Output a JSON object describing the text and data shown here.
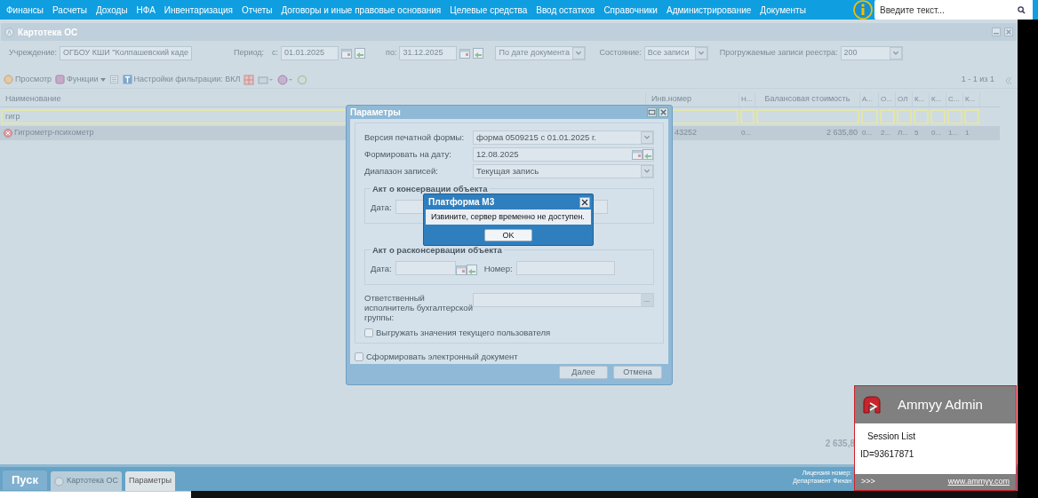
{
  "menu": [
    "Финансы",
    "Расчеты",
    "Доходы",
    "НФА",
    "Инвентаризация",
    "Отчеты",
    "Договоры и иные правовые основания",
    "Целевые средства",
    "Ввод остатков",
    "Справочники",
    "Администрирование",
    "Документы"
  ],
  "search": {
    "placeholder": "Введите текст..."
  },
  "window": {
    "title": "Картотека ОС"
  },
  "filters": {
    "institution_label": "Учреждение:",
    "institution_value": "ОГБОУ КШИ \"Колпашевский каде",
    "period_label": "Период:",
    "from_label": "с:",
    "from_value": "01.01.2025",
    "to_label": "по:",
    "to_value": "31.12.2025",
    "date_mode": "По дате документа",
    "state_label": "Состояние:",
    "state_value": "Все записи",
    "records_label": "Прогружаемые записи реестра:",
    "records_value": "200"
  },
  "toolbar": {
    "items": [
      {
        "label": "Просмотр",
        "kind": "view"
      },
      {
        "label": "Функции",
        "kind": "menu"
      },
      {
        "label": "Настройки фильтрации: ВКЛ",
        "kind": "filter"
      }
    ],
    "pager": "1 - 1 из 1"
  },
  "table": {
    "columns": [
      "Наименование",
      "Инв.номер",
      "Н...",
      "Балансовая стоимость",
      "А...",
      "О...",
      "ОЛ",
      "К...",
      "К...",
      "С...",
      "К..."
    ],
    "filter_value": "гигр",
    "rows": [
      {
        "selected": true,
        "cells": [
          "Гигрометр-психометр",
          "43252",
          "0...",
          "2 635,80",
          "0...",
          "2...",
          "Л...",
          "5",
          "0...",
          "1...",
          "1"
        ]
      }
    ],
    "total": "2 635,8"
  },
  "dialog": {
    "title": "Параметры",
    "fields": [
      {
        "kind": "select",
        "label": "Версия печатной формы:",
        "value": "форма 0509215 с 01.01.2025 г."
      },
      {
        "kind": "date",
        "label": "Формировать на дату:",
        "value": "12.08.2025"
      },
      {
        "kind": "select",
        "label": "Диапазон записей:",
        "value": "Текущая запись"
      }
    ],
    "groups": [
      {
        "legend": "Акт о консервации объекта",
        "date_label": "Дата:"
      },
      {
        "legend": "Акт о расконсервации объекта",
        "date_label": "Дата:",
        "number_label": "Номер:"
      }
    ],
    "responsible_label": "Ответственный исполнитель бухгалтерской группы:",
    "responsible_button": "...",
    "checkboxes": [
      {
        "label": "Выгружать значения текущего пользователя",
        "checked": false
      },
      {
        "label": "Сформировать электронный документ",
        "checked": false
      }
    ],
    "buttons": [
      "Далее",
      "Отмена"
    ]
  },
  "message_box": {
    "title": "Платформа М3",
    "text": "Извините, сервер временно не доступен.",
    "button": "OK"
  },
  "taskbar": {
    "start": "Пуск",
    "tasks": [
      {
        "label": "Картотека ОС",
        "selected": false
      },
      {
        "label": "Параметры",
        "selected": true
      }
    ],
    "license_lines": [
      "Лицензия номер:",
      "Департамент Финан"
    ]
  },
  "ammyy": {
    "title": "Ammyy Admin",
    "heading": "Session List",
    "id": "ID=93617871",
    "more": ">>>",
    "link": "www.ammyy.com"
  }
}
